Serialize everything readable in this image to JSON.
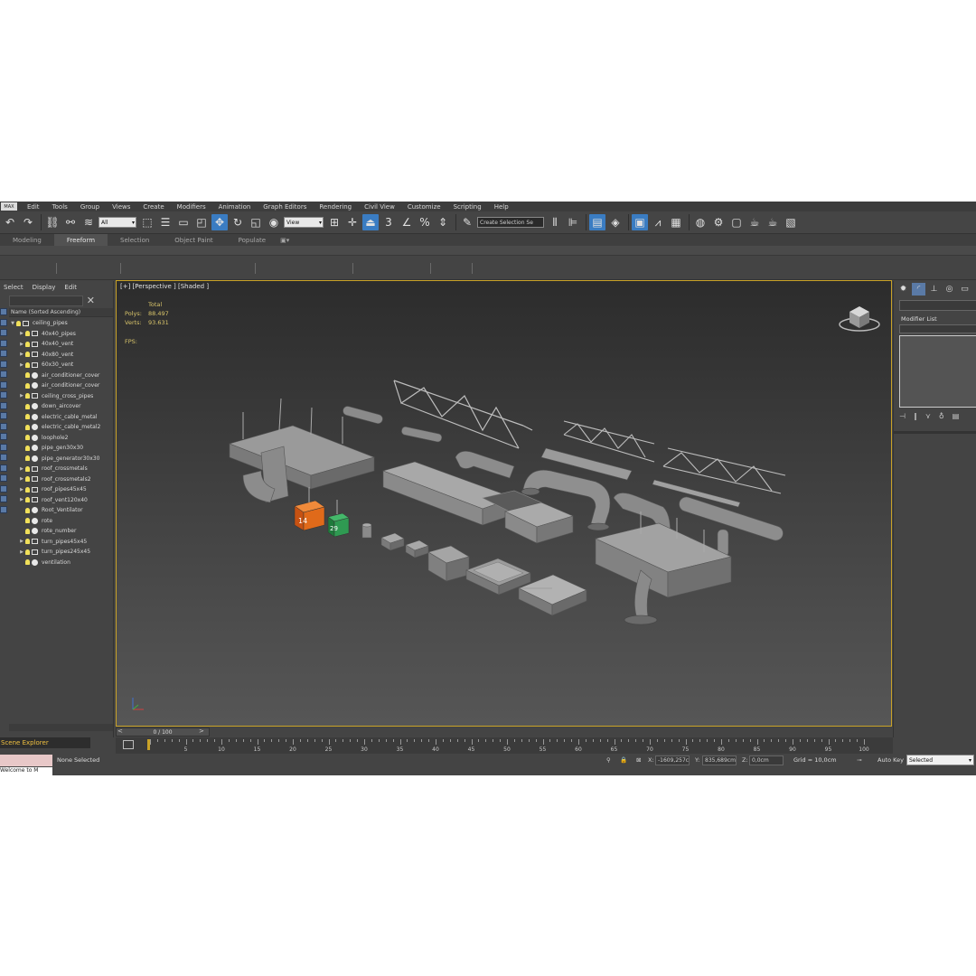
{
  "menu": {
    "logo": "MAX",
    "items": [
      "Edit",
      "Tools",
      "Group",
      "Views",
      "Create",
      "Modifiers",
      "Animation",
      "Graph Editors",
      "Rendering",
      "Civil View",
      "Customize",
      "Scripting",
      "Help"
    ]
  },
  "toolbar": {
    "filter_select": "All",
    "view_select": "View",
    "selection_set": "Create Selection Se"
  },
  "ribbon": {
    "tabs": [
      "Modeling",
      "Freeform",
      "Selection",
      "Object Paint",
      "Populate"
    ],
    "active_tab": "Freeform"
  },
  "scene_explorer": {
    "menu": [
      "Select",
      "Display",
      "Edit"
    ],
    "close_glyph": "✕",
    "column_header": "Name (Sorted Ascending)",
    "items": [
      {
        "name": "ceiling_pipes",
        "level": 0,
        "expanded": true,
        "group": true
      },
      {
        "name": "40x40_pipes",
        "level": 1,
        "arrow": true,
        "group": true
      },
      {
        "name": "40x40_vent",
        "level": 1,
        "arrow": true,
        "group": true
      },
      {
        "name": "40x80_vent",
        "level": 1,
        "arrow": true,
        "group": true
      },
      {
        "name": "60x30_vent",
        "level": 1,
        "arrow": true,
        "group": true
      },
      {
        "name": "air_conditioner_cover",
        "level": 1,
        "arrow": false,
        "group": false
      },
      {
        "name": "air_conditioner_cover",
        "level": 1,
        "arrow": false,
        "group": false
      },
      {
        "name": "ceiling_cross_pipes",
        "level": 1,
        "arrow": true,
        "group": true
      },
      {
        "name": "down_aircover",
        "level": 1,
        "arrow": false,
        "group": false
      },
      {
        "name": "electric_cable_metal",
        "level": 1,
        "arrow": false,
        "group": false
      },
      {
        "name": "electric_cable_metal2",
        "level": 1,
        "arrow": false,
        "group": false
      },
      {
        "name": "loophole2",
        "level": 1,
        "arrow": false,
        "group": false
      },
      {
        "name": "pipe_gen30x30",
        "level": 1,
        "arrow": false,
        "group": false
      },
      {
        "name": "pipe_generator30x30",
        "level": 1,
        "arrow": false,
        "group": false
      },
      {
        "name": "roof_crossmetals",
        "level": 1,
        "arrow": true,
        "group": true
      },
      {
        "name": "roof_crossmetals2",
        "level": 1,
        "arrow": true,
        "group": true
      },
      {
        "name": "roof_pipes45x45",
        "level": 1,
        "arrow": true,
        "group": true
      },
      {
        "name": "roof_vent120x40",
        "level": 1,
        "arrow": true,
        "group": true
      },
      {
        "name": "Root_Ventilator",
        "level": 1,
        "arrow": false,
        "group": false
      },
      {
        "name": "rote",
        "level": 1,
        "arrow": false,
        "group": false
      },
      {
        "name": "rote_number",
        "level": 1,
        "arrow": false,
        "group": false
      },
      {
        "name": "turn_pipes45x45",
        "level": 1,
        "arrow": true,
        "group": true
      },
      {
        "name": "turn_pipes245x45",
        "level": 1,
        "arrow": true,
        "group": true
      },
      {
        "name": "ventilation",
        "level": 1,
        "arrow": false,
        "group": false
      }
    ],
    "tab_label": "Scene Explorer"
  },
  "viewport": {
    "label": "[+] [Perspective ] [Shaded ]",
    "stats": {
      "total_label": "Total",
      "polys_label": "Polys:",
      "polys_value": "88.497",
      "verts_label": "Verts:",
      "verts_value": "93.631",
      "fps_label": "FPS:"
    },
    "box_labels": {
      "orange": "14",
      "green": "29"
    }
  },
  "timeline": {
    "slider": "0 / 100",
    "tick_labels": [
      "5",
      "10",
      "15",
      "20",
      "25",
      "30",
      "35",
      "40",
      "45",
      "50",
      "55",
      "60",
      "65",
      "70",
      "75",
      "80",
      "85",
      "90",
      "95",
      "100"
    ]
  },
  "statusbar": {
    "maxscript": "Welcome to M",
    "message": "None Selected",
    "x_label": "X:",
    "x_value": "-1609,257c",
    "y_label": "Y:",
    "y_value": "835,689cm",
    "z_label": "Z:",
    "z_value": "0,0cm",
    "grid": "Grid = 10,0cm",
    "autokey": "Auto Key",
    "selected": "Selected"
  },
  "command_panel": {
    "modifier_list_label": "Modifier List"
  },
  "colors": {
    "accent_blue": "#3a7cc2",
    "viewport_border": "#c9a227",
    "stats_text": "#d8c46a",
    "orange_box": "#e06a1a",
    "green_box": "#2f9a52"
  }
}
